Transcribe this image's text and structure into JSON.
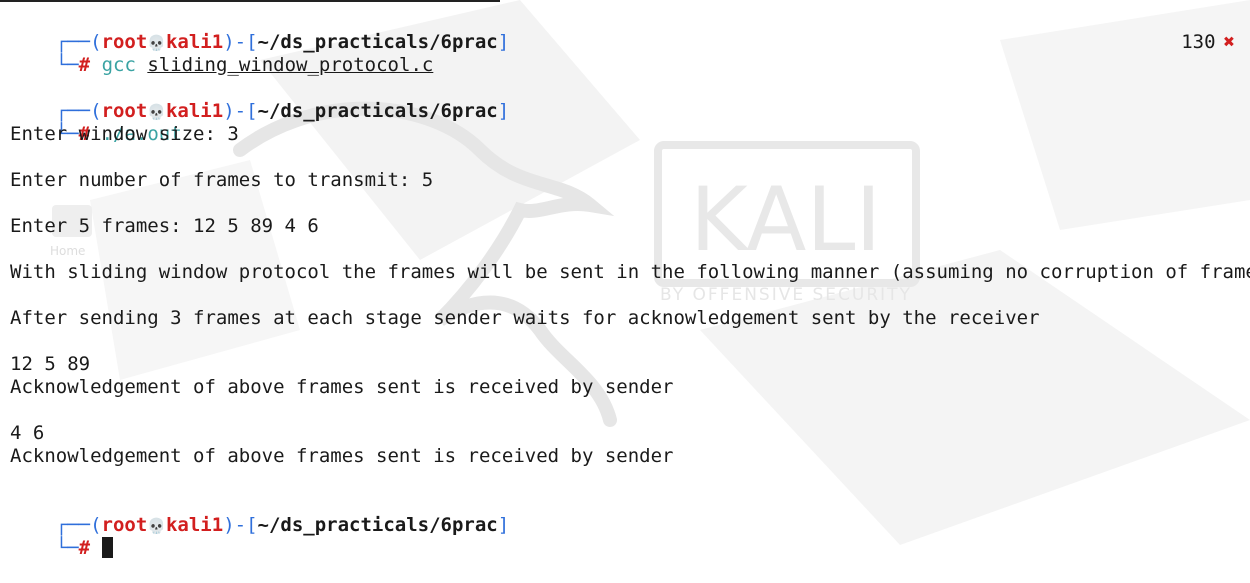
{
  "prompt": {
    "frame_open": "┌──(",
    "frame_close": ")-[",
    "frame_end": "]",
    "frame_bottom": "└─",
    "user": "root",
    "skull": "💀",
    "host": "kali1",
    "path": "~/ds_practicals/6prac",
    "hash": "#"
  },
  "commands": [
    {
      "cmd": "gcc",
      "arg": "sliding_window_protocol.c",
      "exit_code": "130",
      "exit_icon": "✖"
    },
    {
      "cmd": "./a.out"
    }
  ],
  "output": {
    "line1": "Enter window size: 3",
    "line2": "Enter number of frames to transmit: 5",
    "line3": "Enter 5 frames: 12 5 89 4 6",
    "line4": "With sliding window protocol the frames will be sent in the following manner (assuming no corruption of frames)",
    "line5": "After sending 3 frames at each stage sender waits for acknowledgement sent by the receiver",
    "line6": "12 5 89",
    "line7": "Acknowledgement of above frames sent is received by sender",
    "line8": "4 6",
    "line9": "Acknowledgement of above frames sent is received by sender"
  },
  "wallpaper": {
    "logo_text": "KALI",
    "tagline": "BY OFFENSIVE SECURITY",
    "desktop_icon_label": "Home"
  },
  "colors": {
    "prompt_frame": "#2f6fdb",
    "prompt_user": "#d21f1f",
    "command": "#3aa3a3",
    "text": "#1a1a1a"
  }
}
